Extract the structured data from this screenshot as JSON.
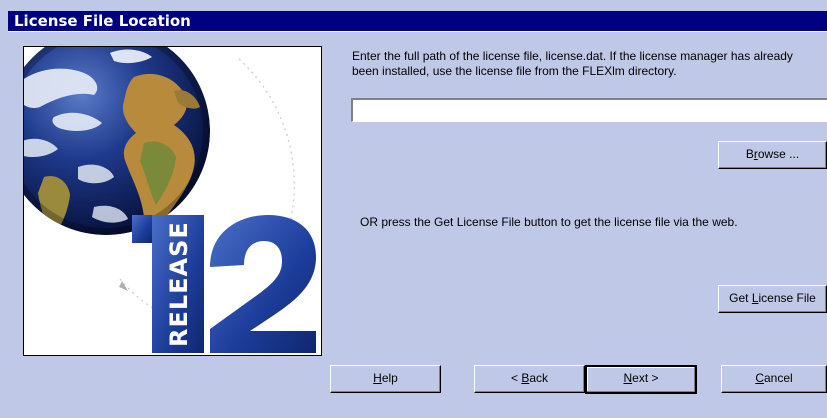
{
  "window": {
    "title": "License File Location"
  },
  "instructions": "Enter the full path of the license file, license.dat.  If the license manager has already been installed, use the license file from the FLEXlm directory.",
  "license_path": {
    "value": "",
    "placeholder": ""
  },
  "browse_button": {
    "before": "B",
    "accel": "r",
    "after": "owse ..."
  },
  "or_text": "OR press the Get License File button to get the license file via the web.",
  "get_license_button": {
    "before": "Get ",
    "accel": "L",
    "after": "icense File"
  },
  "logo": {
    "release_text": "RELEASE",
    "number_text": "12"
  },
  "nav": {
    "help": {
      "before": "",
      "accel": "H",
      "after": "elp"
    },
    "back": {
      "before": "< ",
      "accel": "B",
      "after": "ack"
    },
    "next": {
      "before": "",
      "accel": "N",
      "after": "ext >"
    },
    "cancel": {
      "before": "",
      "accel": "C",
      "after": "ancel"
    }
  },
  "colors": {
    "dialog_bg": "#c0c8e8",
    "titlebar_bg": "#000080",
    "titlebar_text": "#ffffff",
    "logo_blue": "#1e3a8a"
  }
}
